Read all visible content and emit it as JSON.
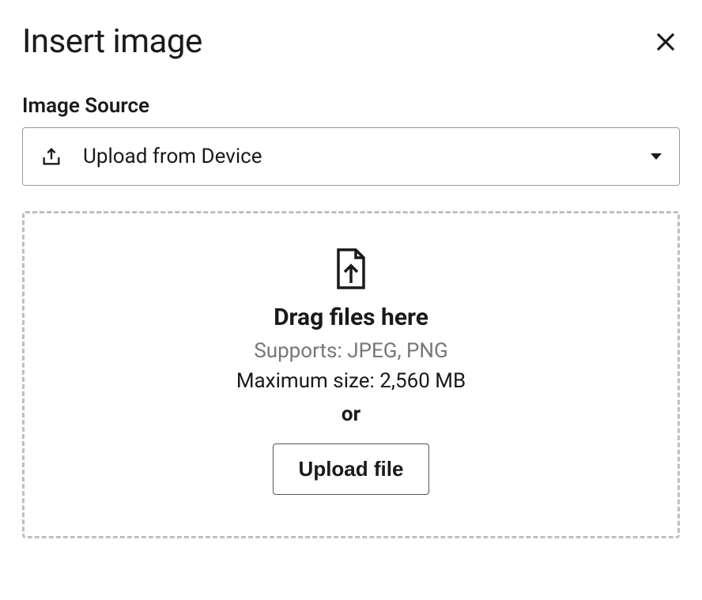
{
  "dialog": {
    "title": "Insert image"
  },
  "field": {
    "label": "Image Source",
    "selected_value": "Upload from Device"
  },
  "dropzone": {
    "drag_text": "Drag files here",
    "supports_text": "Supports: JPEG, PNG",
    "maxsize_text": "Maximum size: 2,560 MB",
    "or_text": "or",
    "upload_button_label": "Upload file"
  }
}
